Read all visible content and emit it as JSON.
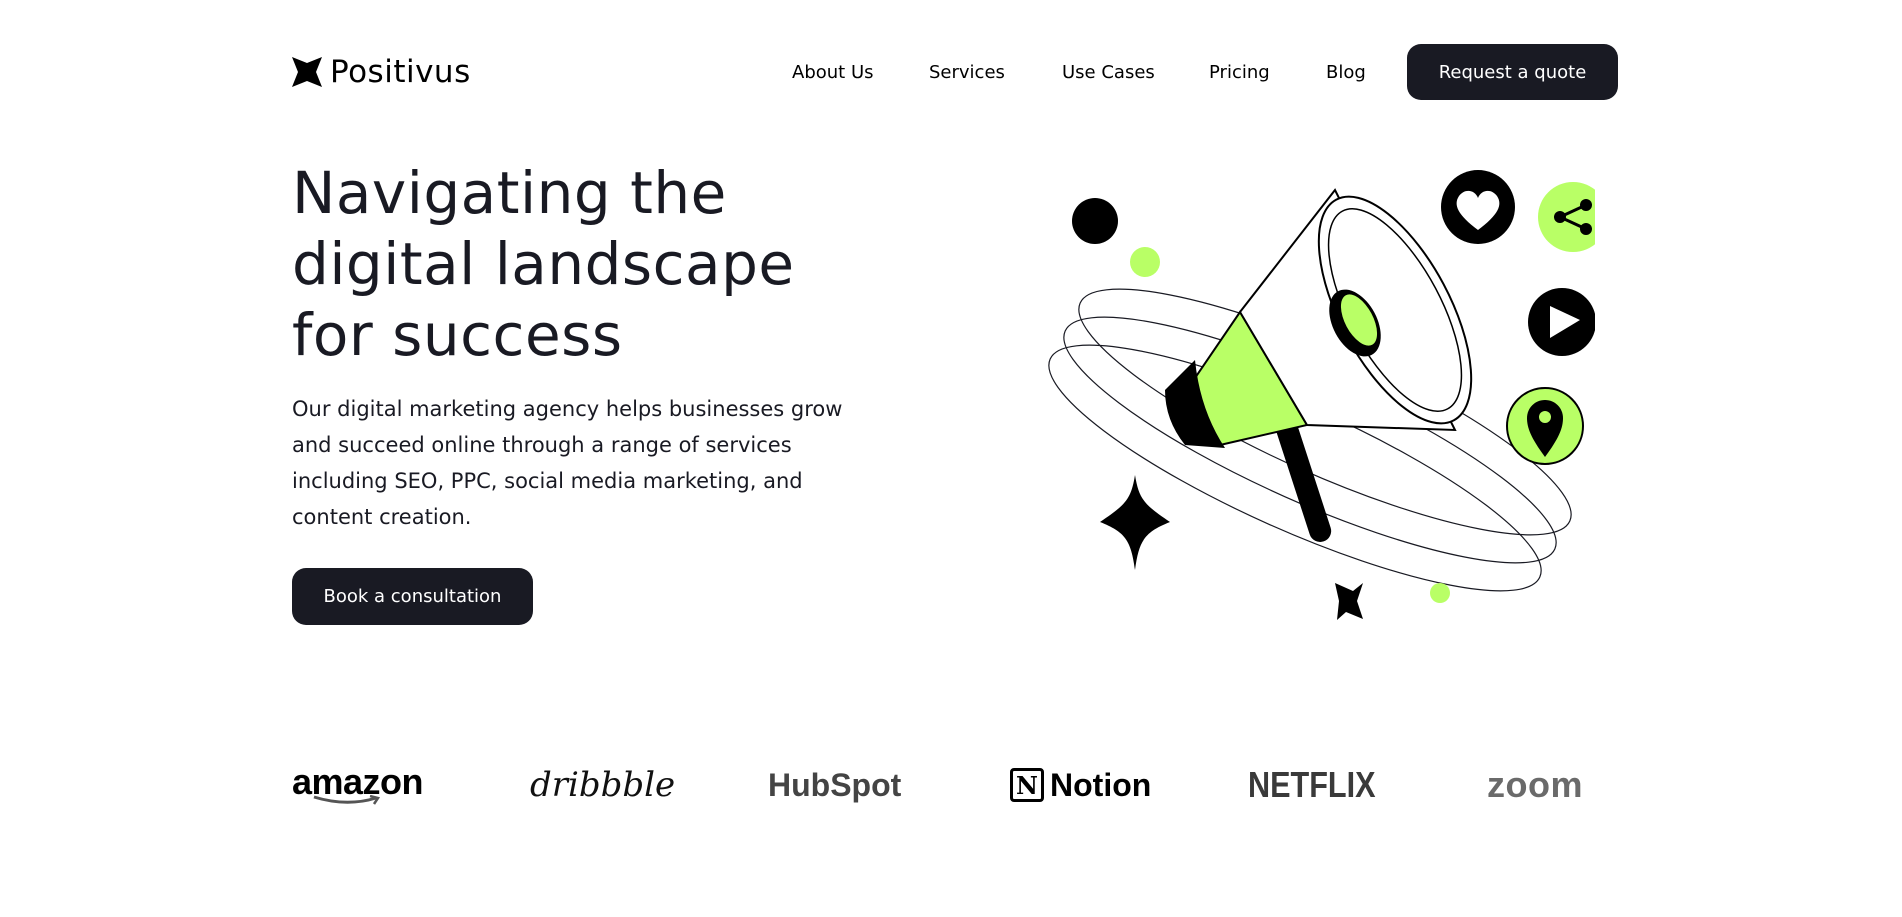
{
  "header": {
    "brand": "Positivus",
    "nav": [
      {
        "label": "About Us"
      },
      {
        "label": "Services"
      },
      {
        "label": "Use Cases"
      },
      {
        "label": "Pricing"
      },
      {
        "label": "Blog"
      }
    ],
    "cta_label": "Request a quote"
  },
  "hero": {
    "title": "Navigating the digital landscape for success",
    "description": "Our digital marketing agency helps businesses grow and succeed online through a range of services including SEO, PPC, social media marketing, and content creation.",
    "cta_label": "Book a consultation",
    "illustration_icons": [
      "megaphone-icon",
      "heart-icon",
      "share-icon",
      "play-icon",
      "location-pin-icon",
      "sparkle-star-icon"
    ]
  },
  "clients": {
    "logos": [
      "amazon",
      "dribbble",
      "HubSpot",
      "Notion",
      "NETFLIX",
      "zoom"
    ]
  },
  "colors": {
    "dark": "#191A23",
    "accent": "#B9FF66",
    "background": "#FFFFFF"
  }
}
